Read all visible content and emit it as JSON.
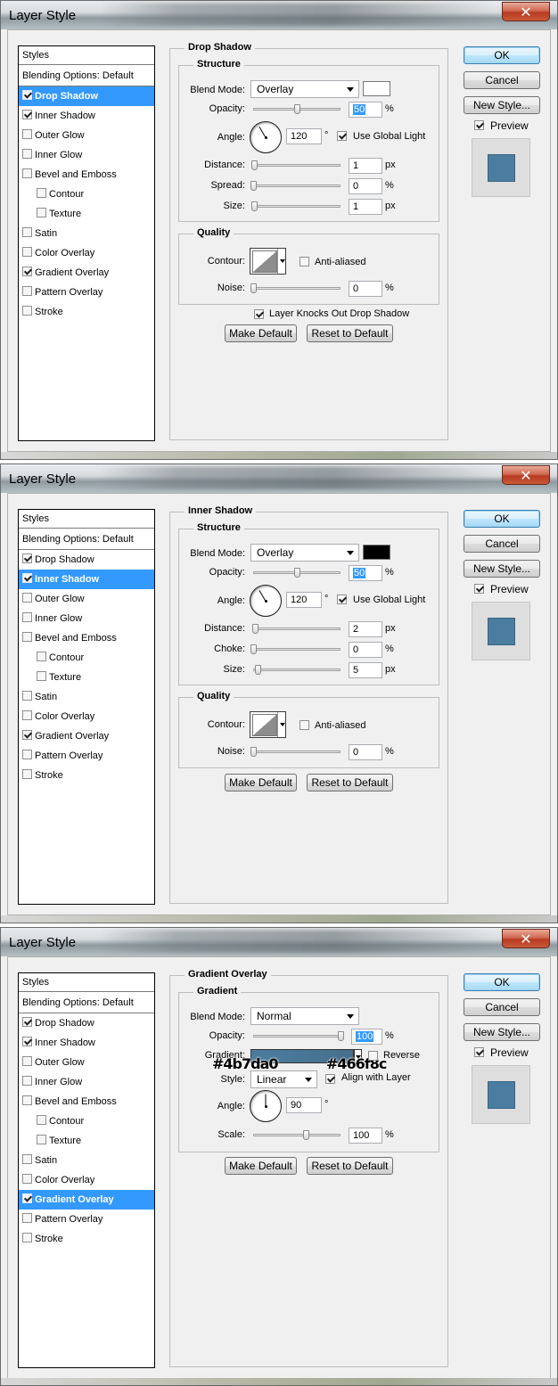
{
  "dialogs": [
    {
      "title": "Layer Style",
      "close_glyph": "✕",
      "styles_header": "Styles",
      "style_items": [
        {
          "label": "Blending Options: Default"
        },
        {
          "label": "Drop Shadow",
          "checked": true,
          "selected": true
        },
        {
          "label": "Inner Shadow",
          "checked": true
        },
        {
          "label": "Outer Glow",
          "checked": false
        },
        {
          "label": "Inner Glow",
          "checked": false
        },
        {
          "label": "Bevel and Emboss",
          "checked": false
        },
        {
          "label": "Contour",
          "checked": false,
          "indent": true
        },
        {
          "label": "Texture",
          "checked": false,
          "indent": true
        },
        {
          "label": "Satin",
          "checked": false
        },
        {
          "label": "Color Overlay",
          "checked": false
        },
        {
          "label": "Gradient Overlay",
          "checked": true
        },
        {
          "label": "Pattern Overlay",
          "checked": false
        },
        {
          "label": "Stroke",
          "checked": false
        }
      ],
      "panel_title": "Drop Shadow",
      "structure_title": "Structure",
      "blend_mode_label": "Blend Mode:",
      "blend_mode": "Overlay",
      "swatch_color": "#ffffff",
      "opacity_label": "Opacity:",
      "opacity": "50",
      "opacity_slider": 0.5,
      "percent": "%",
      "angle_label": "Angle:",
      "angle": "120",
      "degree": "°",
      "use_global_light": "Use Global Light",
      "use_global_light_checked": true,
      "param1_label": "Distance:",
      "param1_value": "1",
      "param1_unit": "px",
      "param1_slider": 0.01,
      "param2_label": "Spread:",
      "param2_value": "0",
      "param2_unit": "%",
      "param2_slider": 0.0,
      "param3_label": "Size:",
      "param3_value": "1",
      "param3_unit": "px",
      "param3_slider": 0.01,
      "quality_title": "Quality",
      "contour_label": "Contour:",
      "anti_aliased": "Anti-aliased",
      "noise_label": "Noise:",
      "noise": "0",
      "knockout_label": "Layer Knocks Out Drop Shadow",
      "knockout_checked": true,
      "make_default": "Make Default",
      "reset_default": "Reset to Default",
      "ok": "OK",
      "cancel": "Cancel",
      "new_style": "New Style...",
      "preview": "Preview",
      "preview_checked": true
    },
    {
      "title": "Layer Style",
      "close_glyph": "✕",
      "styles_header": "Styles",
      "style_items": [
        {
          "label": "Blending Options: Default"
        },
        {
          "label": "Drop Shadow",
          "checked": true
        },
        {
          "label": "Inner Shadow",
          "checked": true,
          "selected": true
        },
        {
          "label": "Outer Glow",
          "checked": false
        },
        {
          "label": "Inner Glow",
          "checked": false
        },
        {
          "label": "Bevel and Emboss",
          "checked": false
        },
        {
          "label": "Contour",
          "checked": false,
          "indent": true
        },
        {
          "label": "Texture",
          "checked": false,
          "indent": true
        },
        {
          "label": "Satin",
          "checked": false
        },
        {
          "label": "Color Overlay",
          "checked": false
        },
        {
          "label": "Gradient Overlay",
          "checked": true
        },
        {
          "label": "Pattern Overlay",
          "checked": false
        },
        {
          "label": "Stroke",
          "checked": false
        }
      ],
      "panel_title": "Inner Shadow",
      "structure_title": "Structure",
      "blend_mode_label": "Blend Mode:",
      "blend_mode": "Overlay",
      "swatch_color": "#000000",
      "opacity_label": "Opacity:",
      "opacity": "50",
      "opacity_slider": 0.5,
      "percent": "%",
      "angle_label": "Angle:",
      "angle": "120",
      "degree": "°",
      "use_global_light": "Use Global Light",
      "use_global_light_checked": true,
      "param1_label": "Distance:",
      "param1_value": "2",
      "param1_unit": "px",
      "param1_slider": 0.02,
      "param2_label": "Choke:",
      "param2_value": "0",
      "param2_unit": "%",
      "param2_slider": 0.0,
      "param3_label": "Size:",
      "param3_value": "5",
      "param3_unit": "px",
      "param3_slider": 0.05,
      "quality_title": "Quality",
      "contour_label": "Contour:",
      "anti_aliased": "Anti-aliased",
      "noise_label": "Noise:",
      "noise": "0",
      "make_default": "Make Default",
      "reset_default": "Reset to Default",
      "ok": "OK",
      "cancel": "Cancel",
      "new_style": "New Style...",
      "preview": "Preview",
      "preview_checked": true
    },
    {
      "title": "Layer Style",
      "close_glyph": "✕",
      "styles_header": "Styles",
      "style_items": [
        {
          "label": "Blending Options: Default"
        },
        {
          "label": "Drop Shadow",
          "checked": true
        },
        {
          "label": "Inner Shadow",
          "checked": true
        },
        {
          "label": "Outer Glow",
          "checked": false
        },
        {
          "label": "Inner Glow",
          "checked": false
        },
        {
          "label": "Bevel and Emboss",
          "checked": false
        },
        {
          "label": "Contour",
          "checked": false,
          "indent": true
        },
        {
          "label": "Texture",
          "checked": false,
          "indent": true
        },
        {
          "label": "Satin",
          "checked": false
        },
        {
          "label": "Color Overlay",
          "checked": false
        },
        {
          "label": "Gradient Overlay",
          "checked": true,
          "selected": true
        },
        {
          "label": "Pattern Overlay",
          "checked": false
        },
        {
          "label": "Stroke",
          "checked": false
        }
      ],
      "panel_title": "Gradient Overlay",
      "gradient_group_title": "Gradient",
      "blend_mode_label": "Blend Mode:",
      "blend_mode": "Normal",
      "opacity_label": "Opacity:",
      "opacity": "100",
      "opacity_slider": 1.0,
      "percent": "%",
      "gradient_label": "Gradient:",
      "gradient_start": "#4b7da0",
      "gradient_end": "#466f8c",
      "reverse_label": "Reverse",
      "reverse_checked": false,
      "style_label": "Style:",
      "style_value": "Linear",
      "align_label": "Align with Layer",
      "align_checked": true,
      "angle_label": "Angle:",
      "angle": "90",
      "degree": "°",
      "scale_label": "Scale:",
      "scale": "100",
      "scale_slider": 0.6,
      "make_default": "Make Default",
      "reset_default": "Reset to Default",
      "ok": "OK",
      "cancel": "Cancel",
      "new_style": "New Style...",
      "preview": "Preview",
      "preview_checked": true
    }
  ]
}
